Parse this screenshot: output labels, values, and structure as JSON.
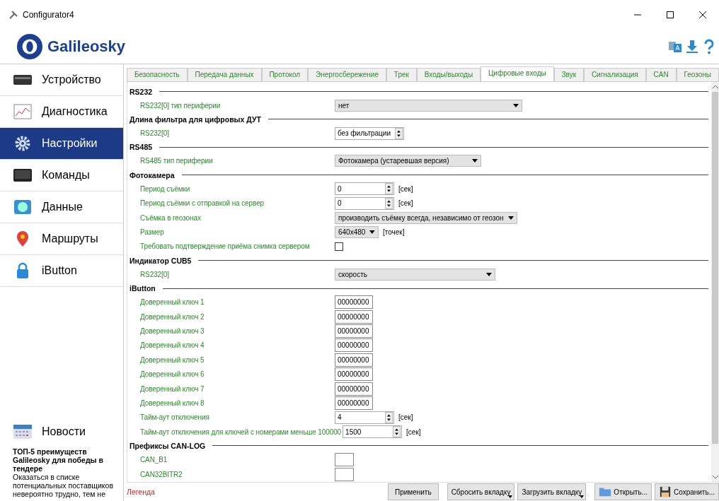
{
  "window": {
    "title": "Configurator4"
  },
  "brand": {
    "name": "Galileosky"
  },
  "sidebar": {
    "items": [
      {
        "label": "Устройство",
        "selected": false
      },
      {
        "label": "Диагностика",
        "selected": false
      },
      {
        "label": "Настройки",
        "selected": true
      },
      {
        "label": "Команды",
        "selected": false
      },
      {
        "label": "Данные",
        "selected": false
      },
      {
        "label": "Маршруты",
        "selected": false
      },
      {
        "label": "iButton",
        "selected": false
      }
    ],
    "news_item": {
      "label": "Новости",
      "selected": false
    },
    "news": {
      "title": "ТОП-5 преимуществ Galileosky для победы в тендере",
      "text": "Оказаться в списке потенциальных поставщиков невероятно трудно, тем не"
    }
  },
  "tabs": [
    {
      "label": "Безопасность",
      "selected": false
    },
    {
      "label": "Передача данных",
      "selected": false
    },
    {
      "label": "Протокол",
      "selected": false
    },
    {
      "label": "Энергосбережение",
      "selected": false
    },
    {
      "label": "Трек",
      "selected": false
    },
    {
      "label": "Входы/выходы",
      "selected": false
    },
    {
      "label": "Цифровые входы",
      "selected": true
    },
    {
      "label": "Звук",
      "selected": false
    },
    {
      "label": "Сигнализация",
      "selected": false
    },
    {
      "label": "CAN",
      "selected": false
    },
    {
      "label": "Геозоны",
      "selected": false
    }
  ],
  "rows": [
    {
      "kind": "section",
      "label": "RS232"
    },
    {
      "kind": "select",
      "label": "RS232[0] тип периферии",
      "value": "нет"
    },
    {
      "kind": "section",
      "label": "Длина фильтра для цифровых ДУТ"
    },
    {
      "kind": "spinselect",
      "label": "RS232[0]",
      "value": "без фильтрации"
    },
    {
      "kind": "section",
      "label": "RS485"
    },
    {
      "kind": "select",
      "label": "RS485 тип периферии",
      "value": "Фотокамера (устаревшая версия)"
    },
    {
      "kind": "section",
      "label": "Фотокамера"
    },
    {
      "kind": "spin",
      "label": "Период съёмки",
      "value": "0",
      "unit": "[сек]"
    },
    {
      "kind": "spin",
      "label": "Период съёмки с отправкой на сервер",
      "value": "0",
      "unit": "[сек]"
    },
    {
      "kind": "select",
      "label": "Съёмка в геозонах",
      "value": "производить съёмку всегда, независимо от геозон"
    },
    {
      "kind": "select",
      "label": "Размер",
      "value": "640x480",
      "unit": "[точек]"
    },
    {
      "kind": "checkbox",
      "label": "Требовать подтверждение приёма снимка сервером",
      "checked": false
    },
    {
      "kind": "section",
      "label": "Индикатор CUB5"
    },
    {
      "kind": "select",
      "label": "RS232[0]",
      "value": "скорость"
    },
    {
      "kind": "section",
      "label": "iButton"
    },
    {
      "kind": "text",
      "label": "Доверенный ключ 1",
      "value": "00000000"
    },
    {
      "kind": "text",
      "label": "Доверенный ключ 2",
      "value": "00000000"
    },
    {
      "kind": "text",
      "label": "Доверенный ключ 3",
      "value": "00000000"
    },
    {
      "kind": "text",
      "label": "Доверенный ключ 4",
      "value": "00000000"
    },
    {
      "kind": "text",
      "label": "Доверенный ключ 5",
      "value": "00000000"
    },
    {
      "kind": "text",
      "label": "Доверенный ключ 6",
      "value": "00000000"
    },
    {
      "kind": "text",
      "label": "Доверенный ключ 7",
      "value": "00000000"
    },
    {
      "kind": "text",
      "label": "Доверенный ключ 8",
      "value": "00000000"
    },
    {
      "kind": "spin",
      "label": "Тайм-аут отключения",
      "value": "4",
      "unit": "[сек]"
    },
    {
      "kind": "spin",
      "label": "Тайм-аут отключения для ключей с номерами меньше 100000",
      "value": "1500",
      "unit": "[сек]"
    },
    {
      "kind": "section",
      "label": "Префиксы CAN-LOG"
    },
    {
      "kind": "text",
      "label": "CAN_B1"
    },
    {
      "kind": "text",
      "label": "CAN32BITR2"
    }
  ],
  "footer": {
    "legend": "Легенда",
    "buttons": [
      {
        "label": "Применить",
        "kind": "plain"
      },
      {
        "label": "Сбросить вкладку",
        "kind": "menu"
      },
      {
        "label": "Загрузить вкладку",
        "kind": "menu"
      },
      {
        "label": "Открыть...",
        "kind": "open"
      },
      {
        "label": "Сохранить...",
        "kind": "save"
      }
    ]
  }
}
